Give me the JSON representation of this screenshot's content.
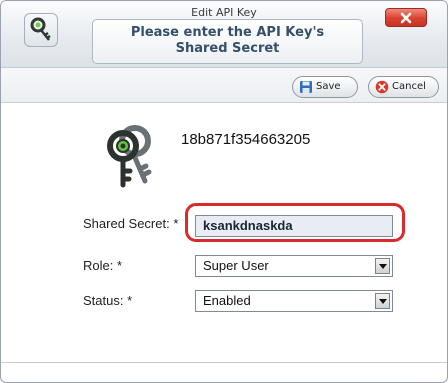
{
  "window": {
    "title": "Edit API Key"
  },
  "header": {
    "prompt_line1": "Please enter the API Key's",
    "prompt_line2": "Shared Secret"
  },
  "toolbar": {
    "save_label": "Save",
    "cancel_label": "Cancel"
  },
  "key": {
    "id": "18b871f354663205"
  },
  "form": {
    "shared_secret_label": "Shared Secret:",
    "shared_secret_value": "ksankdnaskda",
    "role_label": "Role:",
    "role_value": "Super User",
    "status_label": "Status:",
    "status_value": "Enabled",
    "required_marker": "*"
  },
  "colors": {
    "highlight": "#d92b2b",
    "close_button": "#d9422f",
    "prompt_text": "#34506a"
  }
}
